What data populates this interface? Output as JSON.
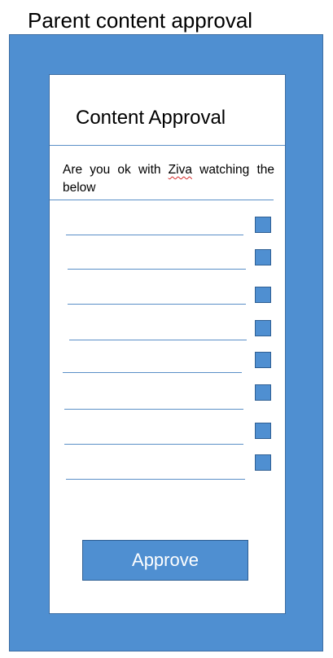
{
  "page": {
    "heading": "Parent content approval"
  },
  "card": {
    "title": "Content Approval",
    "question_prefix": "Are you ok with ",
    "child_name": "Ziva",
    "question_suffix": " watching the below",
    "item_count": 8,
    "approve_label": "Approve"
  },
  "colors": {
    "frame": "#4f8fd1",
    "border": "#3d6ea3",
    "line": "#5a8fc7",
    "spellcheck_underline": "#d62b2b"
  }
}
